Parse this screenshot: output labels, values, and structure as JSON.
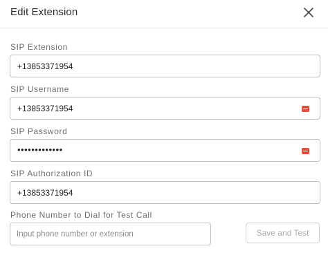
{
  "dialog": {
    "title": "Edit Extension"
  },
  "fields": {
    "sip_extension": {
      "label": "SIP Extension",
      "value": "+13853371954"
    },
    "sip_username": {
      "label": "SIP Username",
      "value": "+13853371954"
    },
    "sip_password": {
      "label": "SIP Password",
      "value": "•••••••••••••"
    },
    "sip_authorization_id": {
      "label": "SIP Authorization ID",
      "value": "+13853371954"
    },
    "test_call": {
      "label": "Phone Number to Dial for Test Call",
      "value": "",
      "placeholder": "Input phone number or extension"
    }
  },
  "actions": {
    "save_and_test_label": "Save and Test"
  },
  "icons": {
    "close": "close-icon",
    "password_manager": "password-manager-icon"
  },
  "colors": {
    "password_manager_icon": "#e64a3b",
    "border": "#bdbdbd",
    "label_text": "#6e6e6e"
  }
}
